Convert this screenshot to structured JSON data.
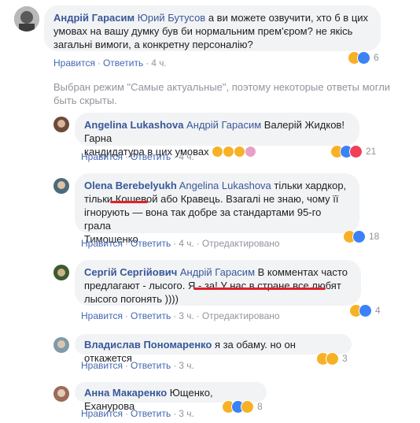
{
  "comments": [
    {
      "author": "Андрій Гарасим",
      "mention": "Юрий Бутусов",
      "line1": " а ви можете озвучити, хто б в цих",
      "line2": "умовах на вашу думку був би нормальним прем'єром? не якісь",
      "line3": "загальні вимоги, а конкретну персоналію?",
      "like": "Нравится",
      "reply": "Ответить",
      "time": "4 ч.",
      "reactions_count": "6"
    },
    {
      "author": "Angelina Lukashova",
      "mention": "Андрій Гарасим",
      "line1": " Валерій Жидков! Гарна",
      "line2": "кандидатура в цих умовах",
      "like": "Нравится",
      "reply": "Ответить",
      "time": "4 ч.",
      "reactions_count": "21"
    },
    {
      "author": "Olena Berebelyukh",
      "mention": "Angelina Lukashova",
      "line1": " тільки хардкор,",
      "line2a": "тільки ",
      "line2b": "Кошевой",
      "line2c": " або Кравець. Взагалі не знаю, чому її",
      "line3": "ігнорують — вона так добре за стандартами 95-го грала",
      "line4": "Тимошенко",
      "like": "Нравится",
      "reply": "Ответить",
      "time": "4 ч.",
      "edited": "Отредактировано",
      "reactions_count": "18"
    },
    {
      "author": "Сергій Сергійович",
      "mention": "Андрій Гарасим",
      "line1": " В комментах часто",
      "line2": "предлагают - лысого. Я - за! У нас в стране все любят",
      "line3": "лысого погонять ))))",
      "like": "Нравится",
      "reply": "Ответить",
      "time": "3 ч.",
      "edited": "Отредактировано",
      "reactions_count": "4"
    },
    {
      "author": "Владислав Пономаренко",
      "line1": " я за обаму. но он откажется",
      "like": "Нравится",
      "reply": "Ответить",
      "time": "3 ч.",
      "reactions_count": "3"
    },
    {
      "author": "Анна Макаренко",
      "line1": " Ющенко, Еханурова",
      "line1_display": " Ющенко, Еханурова",
      "like": "Нравится",
      "reply": "Ответить",
      "time": "3 ч.",
      "reactions_count": "8"
    }
  ],
  "notice": {
    "line1": "Выбран режим \"Самые актуальные\", поэтому некоторые ответы могли",
    "line2": "быть скрыты."
  },
  "separator": "·",
  "colors": {
    "link": "#385898",
    "action": "#4267b2",
    "bubble": "#f2f3f5",
    "underline": "#e0212b"
  },
  "icons": [
    "haha-icon",
    "like-icon",
    "love-icon",
    "sad-icon",
    "wow-icon"
  ]
}
